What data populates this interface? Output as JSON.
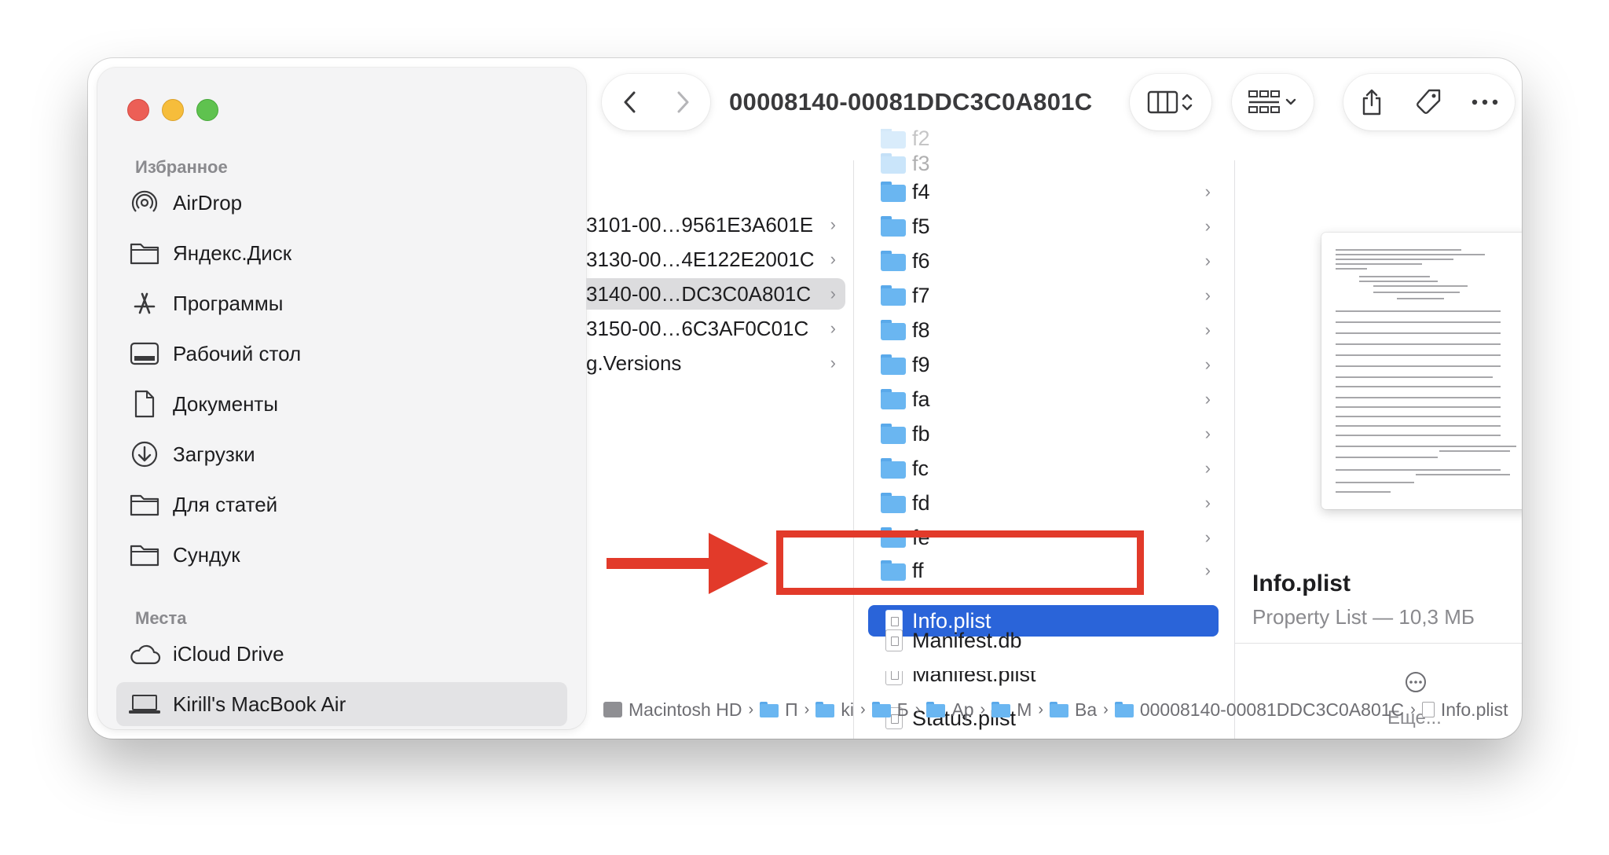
{
  "window": {
    "title": "00008140-00081DDC3C0A801C"
  },
  "sidebar": {
    "favorites_title": "Избранное",
    "places_title": "Места",
    "favorites": [
      {
        "label": "AirDrop",
        "icon": "airdrop-icon"
      },
      {
        "label": "Яндекс.Диск",
        "icon": "folder-icon"
      },
      {
        "label": "Программы",
        "icon": "applications-icon"
      },
      {
        "label": "Рабочий стол",
        "icon": "desktop-icon"
      },
      {
        "label": "Документы",
        "icon": "document-icon"
      },
      {
        "label": "Загрузки",
        "icon": "downloads-icon"
      },
      {
        "label": "Для статей",
        "icon": "folder-icon"
      },
      {
        "label": "Сундук",
        "icon": "folder-icon"
      }
    ],
    "places": [
      {
        "label": "iCloud Drive",
        "icon": "cloud-icon"
      },
      {
        "label": "Kirill's MacBook Air",
        "icon": "laptop-icon",
        "selected": true
      }
    ]
  },
  "column1": {
    "items": [
      {
        "label": "3101-00…9561E3A601E"
      },
      {
        "label": "3130-00…4E122E2001C"
      },
      {
        "label": "3140-00…DC3C0A801C",
        "selected": true
      },
      {
        "label": "3150-00…6C3AF0C01C"
      },
      {
        "label": "g.Versions"
      }
    ]
  },
  "column2": {
    "top_partial": [
      "f2",
      "f3"
    ],
    "folders": [
      "f4",
      "f5",
      "f6",
      "f7",
      "f8",
      "f9",
      "fa",
      "fb",
      "fc",
      "fd",
      "fe",
      "ff"
    ],
    "selected_file": "Info.plist",
    "files_after": [
      "Manifest.db",
      "Manifest.plist",
      "Status.plist"
    ]
  },
  "preview": {
    "name": "Info.plist",
    "kind": "Property List — 10,3 МБ",
    "more_label": "Еще..."
  },
  "pathbar": [
    {
      "label": "Macintosh HD",
      "icon": "disk-icon"
    },
    {
      "label": "П",
      "icon": "folder-icon"
    },
    {
      "label": "ki",
      "icon": "folder-icon"
    },
    {
      "label": "Б",
      "icon": "folder-icon"
    },
    {
      "label": "Ap",
      "icon": "folder-icon"
    },
    {
      "label": "M",
      "icon": "folder-icon"
    },
    {
      "label": "Ba",
      "icon": "folder-icon"
    },
    {
      "label": "00008140-00081DDC3C0A801C",
      "icon": "folder-icon"
    },
    {
      "label": "Info.plist",
      "icon": "document-icon"
    }
  ],
  "colors": {
    "selection": "#2a64d9",
    "annotation": "#e23a2a",
    "folder": "#6ab6f1"
  }
}
